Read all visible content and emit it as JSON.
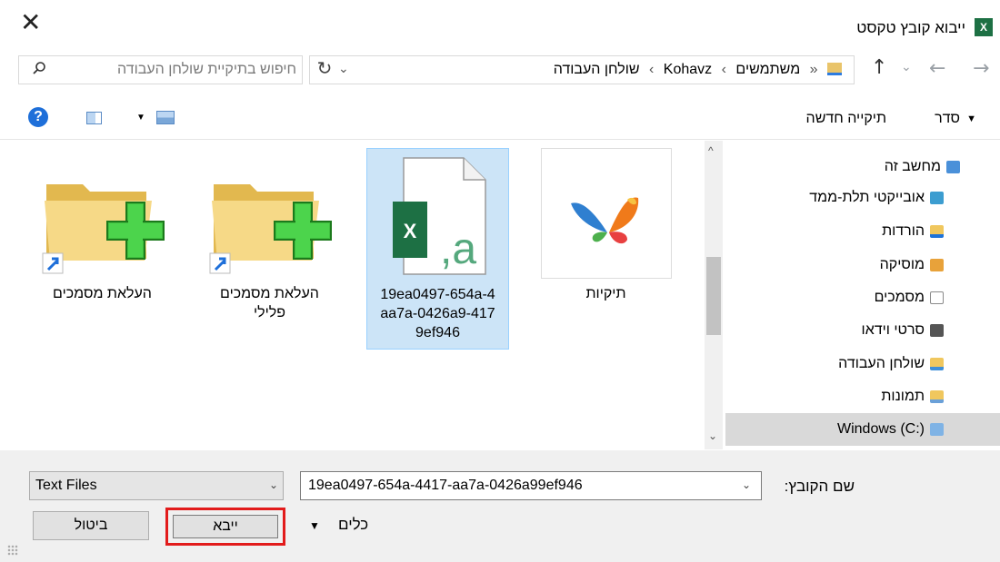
{
  "window": {
    "title": "ייבוא קובץ טקסט",
    "app_icon": "excel-icon",
    "close_glyph": "✕"
  },
  "address": {
    "crumbs": [
      "«",
      "משתמשים",
      "Kohavz",
      "שולחן העבודה"
    ],
    "separator": "›"
  },
  "search": {
    "placeholder": "חיפוש בתיקיית שולחן העבודה"
  },
  "toolbar": {
    "organize": "סדר",
    "new_folder": "תיקייה חדשה",
    "help": "?"
  },
  "nav_tree": [
    {
      "label": "מחשב זה",
      "icon": "computer-icon",
      "color": "#4a90d9"
    },
    {
      "label": "אובייקטי תלת-ממד",
      "icon": "3d-objects-icon",
      "color": "#3c9dd0"
    },
    {
      "label": "הורדות",
      "icon": "downloads-icon",
      "color": "#1e73d9"
    },
    {
      "label": "מוסיקה",
      "icon": "music-icon",
      "color": "#e8a23a"
    },
    {
      "label": "מסמכים",
      "icon": "documents-icon",
      "color": "#8a8a8a"
    },
    {
      "label": "סרטי וידאו",
      "icon": "videos-icon",
      "color": "#555555"
    },
    {
      "label": "שולחן העבודה",
      "icon": "desktop-icon",
      "color": "#3f8fd8"
    },
    {
      "label": "תמונות",
      "icon": "pictures-icon",
      "color": "#6aa0d8"
    },
    {
      "label": "Windows (C:)",
      "icon": "drive-icon",
      "color": "#7fb3e5"
    }
  ],
  "files": [
    {
      "label": "תיקיות",
      "icon": "msn-butterfly-icon",
      "selected": false
    },
    {
      "label": "19ea0497-654a-4417-aa7a-0426a99ef946",
      "label_lines": [
        "19ea0497-654a-4",
        "417-aa7a-0426a9",
        "9ef946"
      ],
      "icon": "excel-file-icon",
      "selected": true
    },
    {
      "label": "העלאת מסמכים פלילי",
      "label_lines": [
        "העלאת מסמכים",
        "פלילי"
      ],
      "icon": "folder-shortcut-icon",
      "selected": false
    },
    {
      "label": "העלאת מסמכים",
      "icon": "folder-shortcut-icon",
      "selected": false
    }
  ],
  "footer": {
    "file_name_label": "שם הקובץ:",
    "file_name_value": "19ea0497-654a-4417-aa7a-0426a99ef946",
    "file_type_value": "Text Files",
    "tools_label": "כלים",
    "import_label": "ייבא",
    "cancel_label": "ביטול"
  },
  "colors": {
    "selection_bg": "#cce4f7",
    "highlight_border": "#e21b1b",
    "excel_green": "#1d7044"
  }
}
